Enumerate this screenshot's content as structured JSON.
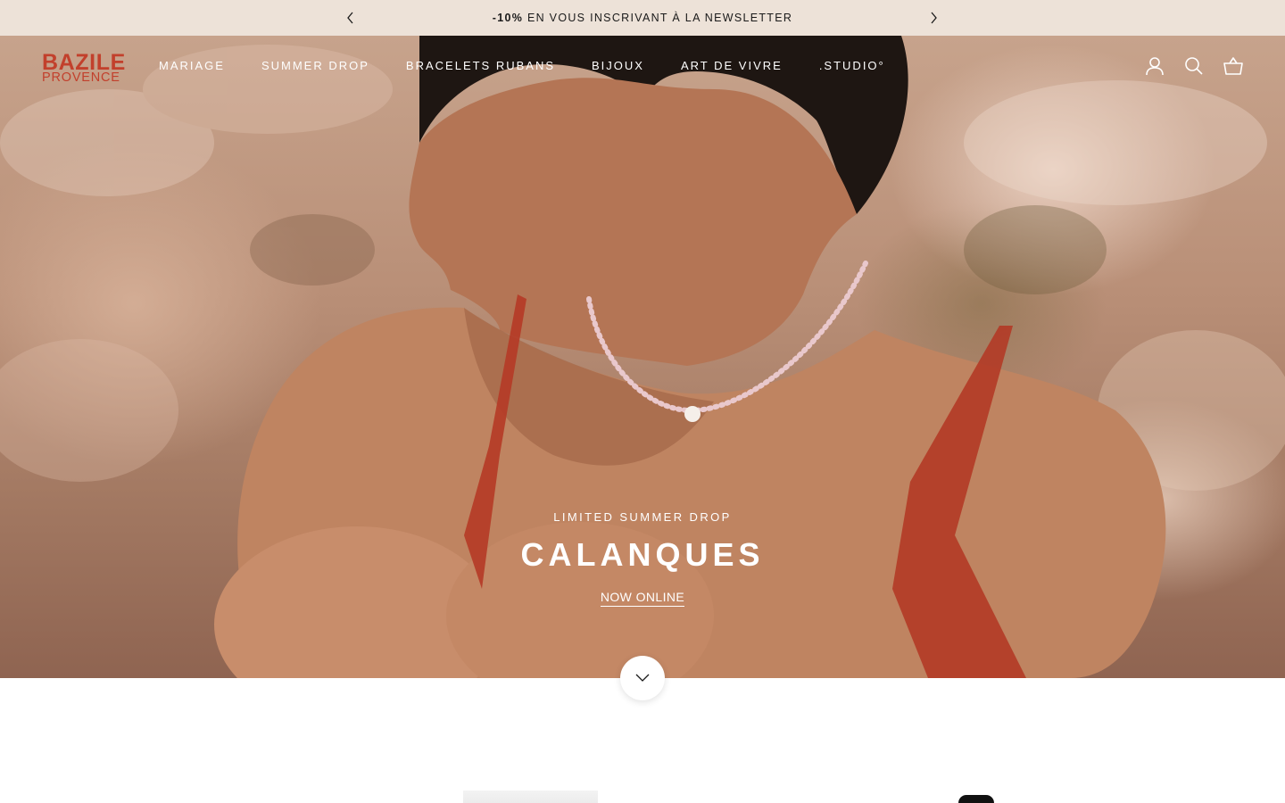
{
  "announcement": {
    "highlight": "-10%",
    "text": " EN VOUS INSCRIVANT À LA NEWSLETTER",
    "prev_icon": "chevron-left-icon",
    "next_icon": "chevron-right-icon"
  },
  "brand": {
    "line1": "BAZILE",
    "line2": "PROVENCE",
    "color": "#c2402c"
  },
  "nav": {
    "items": [
      "MARIAGE",
      "SUMMER DROP",
      "BRACELETS RUBANS",
      "BIJOUX",
      "ART DE VIVRE",
      ".STUDIO°"
    ]
  },
  "header_icons": [
    "account-icon",
    "search-icon",
    "cart-icon"
  ],
  "hero": {
    "subtitle": "LIMITED SUMMER DROP",
    "title": "CALANQUES",
    "cta": "NOW ONLINE",
    "scroll_icon": "chevron-down-icon"
  },
  "colors": {
    "announcement_bg": "#ede2d8",
    "text_dark": "#1a1a1a",
    "hero_text": "#ffffff"
  }
}
